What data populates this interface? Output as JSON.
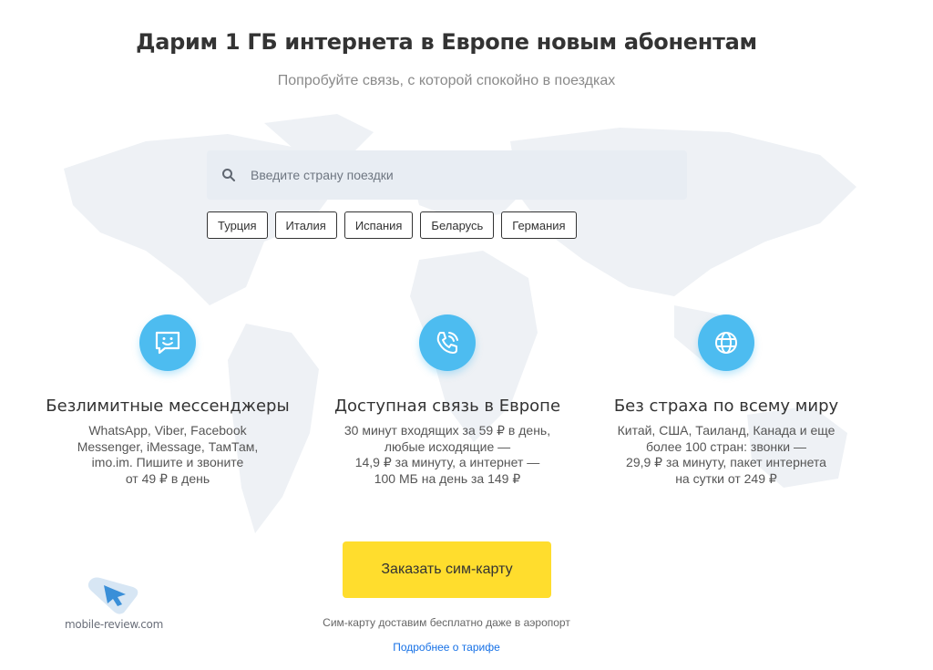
{
  "header": {
    "title": "Дарим 1 ГБ интернета в Европе новым абонентам",
    "subtitle": "Попробуйте связь, с которой спокойно в поездках"
  },
  "search": {
    "placeholder": "Введите страну поездки",
    "icon": "search-icon"
  },
  "chips": [
    "Турция",
    "Италия",
    "Испания",
    "Беларусь",
    "Германия"
  ],
  "features": [
    {
      "icon": "chat-smile-icon",
      "title": "Безлимитные мессенджеры",
      "lines": [
        "WhatsApp, Viber, Facebook",
        "Messenger, iMessage, ТамТам,",
        "imo.im. Пишите и звоните",
        "от 49 ₽ в день"
      ]
    },
    {
      "icon": "phone-call-icon",
      "title": "Доступная связь в Европе",
      "lines": [
        "30 минут входящих за 59 ₽ в день,",
        "любые исходящие —",
        "14,9 ₽ за минуту, а интернет —",
        "100 МБ на день за 149 ₽"
      ]
    },
    {
      "icon": "globe-icon",
      "title": "Без страха по всему миру",
      "lines": [
        "Китай, США, Таиланд, Канада и еще",
        "более 100 стран: звонки —",
        "29,9 ₽ за минуту, пакет интернета",
        "на сутки от 249 ₽"
      ]
    }
  ],
  "cta": {
    "label": "Заказать сим-карту",
    "note": "Сим-карту доставим бесплатно даже в аэропорт",
    "link": "Подробнее о тарифе"
  },
  "watermark": {
    "text": "mobile-review.com"
  },
  "colors": {
    "accent_yellow": "#ffdd2d",
    "icon_blue": "#4dbcf0",
    "link_blue": "#1771e6",
    "search_bg": "#e8edf3",
    "map_bg": "#eef1f5"
  }
}
